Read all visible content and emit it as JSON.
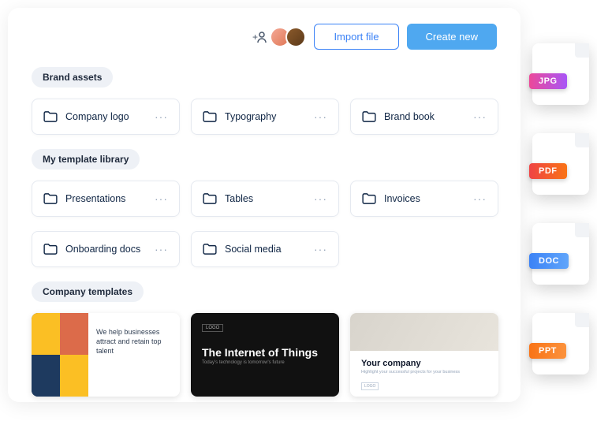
{
  "header": {
    "import_label": "Import file",
    "create_label": "Create new"
  },
  "sections": {
    "brand_assets": {
      "title": "Brand assets",
      "folders": [
        "Company logo",
        "Typography",
        "Brand book"
      ]
    },
    "template_library": {
      "title": "My template library",
      "folders_row1": [
        "Presentations",
        "Tables",
        "Invoices"
      ],
      "folders_row2": [
        "Onboarding docs",
        "Social media"
      ]
    },
    "company_templates": {
      "title": "Company templates",
      "cards": [
        {
          "headline": "We help businesses attract and retain top talent"
        },
        {
          "logo": "LOGO",
          "title": "The Internet of Things",
          "subtitle": "Today's technology is tomorrow's future"
        },
        {
          "logo": "LOGO",
          "title": "Your company",
          "subtitle": "Highlight your successful projects for your business"
        }
      ]
    }
  },
  "file_types": [
    "JPG",
    "PDF",
    "DOC",
    "PPT"
  ],
  "more_glyph": "···"
}
